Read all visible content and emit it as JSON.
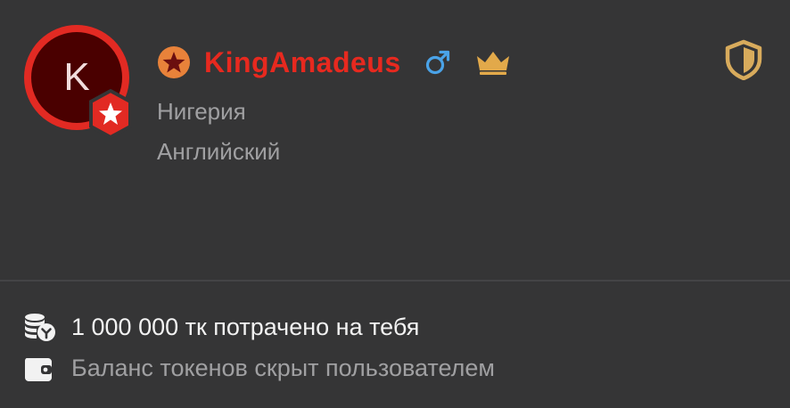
{
  "profile": {
    "avatar_letter": "K",
    "username": "KingAmadeus",
    "country": "Нигерия",
    "language": "Английский",
    "icons": {
      "rank": "star-rank-icon",
      "avatar_badge": "star-badge-icon",
      "gender": "male-gender-icon",
      "vip": "crown-icon",
      "status": "shield-icon"
    }
  },
  "stats": {
    "spent_text": "1 000 000 тк потрачено на тебя",
    "spent_icon": "coins-icon",
    "balance_text": "Баланс токенов скрыт пользователем",
    "balance_icon": "wallet-icon"
  },
  "colors": {
    "background": "#353536",
    "username": "#e7291f",
    "avatar_ring": "#e22a23",
    "avatar_fill": "#4a0000",
    "rank_badge": "#e8823a",
    "gender": "#4aa3e8",
    "crown": "#e2a94a",
    "shield": "#d8ab5c",
    "muted_text": "#a0a0a2",
    "primary_text": "#f2f2f2"
  }
}
